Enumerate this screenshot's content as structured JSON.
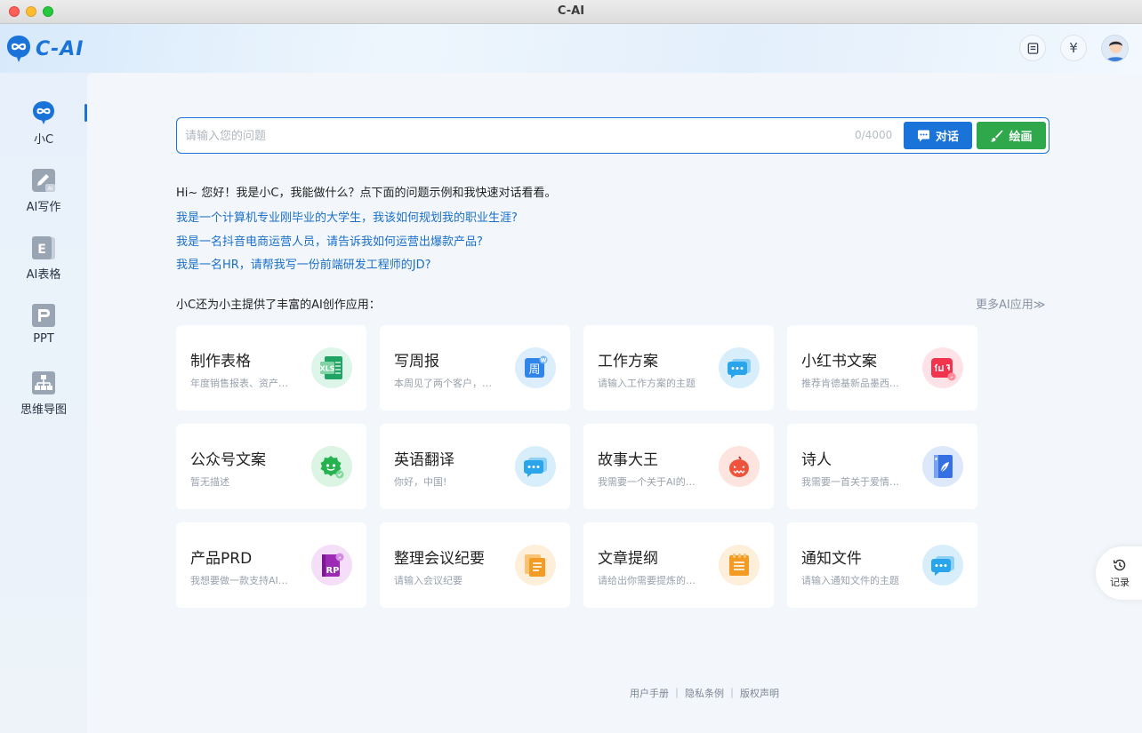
{
  "window": {
    "title": "C-AI"
  },
  "header": {
    "logo_text": "C-AI",
    "yuan_symbol": "¥"
  },
  "sidebar": {
    "items": [
      {
        "label": "小C",
        "icon": "infinity-bubble-icon",
        "active": true
      },
      {
        "label": "AI写作",
        "icon": "pen-ai-icon",
        "active": false
      },
      {
        "label": "AI表格",
        "icon": "sheet-e-icon",
        "active": false
      },
      {
        "label": "PPT",
        "icon": "ppt-p-icon",
        "active": false
      },
      {
        "label": "思维导图",
        "icon": "mindmap-icon",
        "active": false
      }
    ]
  },
  "search": {
    "placeholder": "请输入您的问题",
    "value": "",
    "counter": "0/4000",
    "chat_label": "对话",
    "draw_label": "绘画"
  },
  "greeting": "Hi~ 您好！我是小C，我能做什么？点下面的问题示例和我快速对话看看。",
  "examples": [
    "我是一个计算机专业刚毕业的大学生，我该如何规划我的职业生涯?",
    "我是一名抖音电商运营人员，请告诉我如何运营出爆款产品?",
    "我是一名HR，请帮我写一份前端研发工程师的JD?"
  ],
  "apps_section": {
    "title": "小C还为小主提供了丰富的AI创作应用：",
    "more_label": "更多AI应用"
  },
  "apps": [
    {
      "title": "制作表格",
      "desc": "年度销售报表、资产负债表",
      "icon": "excel-icon",
      "color": "#1fa463",
      "bg": "#def5e9"
    },
    {
      "title": "写周报",
      "desc": "本周见了两个客户，完成了",
      "icon": "weekly-report-icon",
      "color": "#2f86e8",
      "bg": "#dcedfb"
    },
    {
      "title": "工作方案",
      "desc": "请输入工作方案的主题",
      "icon": "chat-bubble-icon",
      "color": "#2aa5ec",
      "bg": "#d9eefb"
    },
    {
      "title": "小红书文案",
      "desc": "推荐肯德基新品墨西哥鸡肉卷",
      "icon": "xiaohongshu-icon",
      "color": "#f2334e",
      "bg": "#fde3e7"
    },
    {
      "title": "公众号文案",
      "desc": "暂无描述",
      "icon": "wechat-icon",
      "color": "#25b24f",
      "bg": "#dcf4e3"
    },
    {
      "title": "英语翻译",
      "desc": "你好，中国!",
      "icon": "chat-bubble-icon",
      "color": "#2aa5ec",
      "bg": "#d9eefb"
    },
    {
      "title": "故事大王",
      "desc": "我需要一个关于AI的故事",
      "icon": "pumpkin-icon",
      "color": "#f0533b",
      "bg": "#fde4df"
    },
    {
      "title": "诗人",
      "desc": "我需要一首关于爱情的诗",
      "icon": "notebook-icon",
      "color": "#3470e4",
      "bg": "#dde8fb"
    },
    {
      "title": "产品PRD",
      "desc": "我想要做一款支持AI对话的",
      "icon": "rp-icon",
      "color": "#9c2ab4",
      "bg": "#f4def8"
    },
    {
      "title": "整理会议纪要",
      "desc": "请输入会议纪要",
      "icon": "documents-icon",
      "color": "#f39b22",
      "bg": "#fdefd9"
    },
    {
      "title": "文章提纲",
      "desc": "请给出你需要提炼的文章",
      "icon": "outline-icon",
      "color": "#f39b22",
      "bg": "#fdefd9"
    },
    {
      "title": "通知文件",
      "desc": "请输入通知文件的主题",
      "icon": "chat-bubble-icon",
      "color": "#2aa5ec",
      "bg": "#d9eefb"
    }
  ],
  "footer": {
    "text": "用户手册 ｜ 隐私条例 ｜ 版权声明"
  },
  "record": {
    "label": "记录"
  },
  "colors": {
    "accent": "#1a73d9",
    "draw_green": "#2ea84b"
  }
}
